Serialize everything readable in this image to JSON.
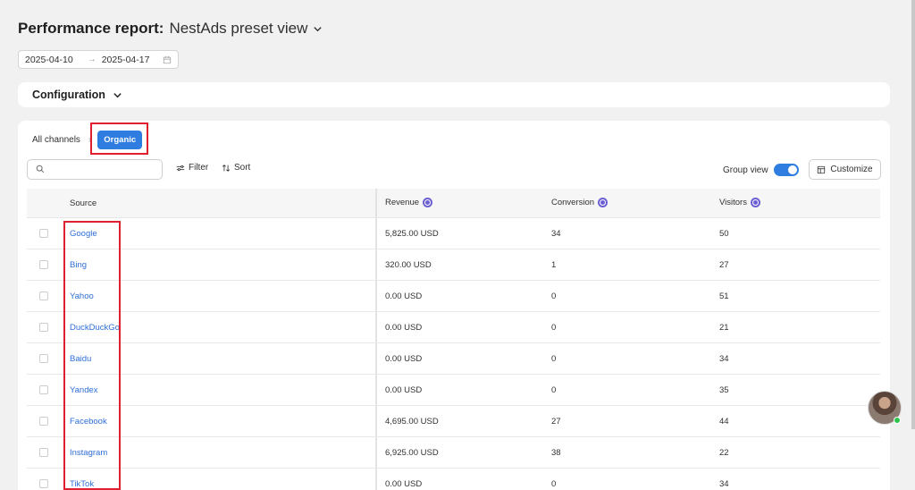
{
  "header": {
    "title": "Performance report:",
    "view_name": "NestAds preset view"
  },
  "date_range": {
    "start": "2025-04-10",
    "arrow": "→",
    "end": "2025-04-17"
  },
  "configuration": {
    "label": "Configuration"
  },
  "breadcrumb": {
    "root": "All channels",
    "separator": "›",
    "current": "Organic"
  },
  "toolbar": {
    "search_placeholder": "",
    "filter_label": "Filter",
    "sort_label": "Sort",
    "group_view_label": "Group view",
    "group_view_on": true,
    "customize_label": "Customize"
  },
  "table": {
    "columns": [
      "Source",
      "Revenue",
      "Conversion",
      "Visitors"
    ],
    "rows": [
      {
        "source": "Google",
        "revenue": "5,825.00 USD",
        "conversion": "34",
        "visitors": "50"
      },
      {
        "source": "Bing",
        "revenue": "320.00 USD",
        "conversion": "1",
        "visitors": "27"
      },
      {
        "source": "Yahoo",
        "revenue": "0.00 USD",
        "conversion": "0",
        "visitors": "51"
      },
      {
        "source": "DuckDuckGo",
        "revenue": "0.00 USD",
        "conversion": "0",
        "visitors": "21"
      },
      {
        "source": "Baidu",
        "revenue": "0.00 USD",
        "conversion": "0",
        "visitors": "34"
      },
      {
        "source": "Yandex",
        "revenue": "0.00 USD",
        "conversion": "0",
        "visitors": "35"
      },
      {
        "source": "Facebook",
        "revenue": "4,695.00 USD",
        "conversion": "27",
        "visitors": "44"
      },
      {
        "source": "Instagram",
        "revenue": "6,925.00 USD",
        "conversion": "38",
        "visitors": "22"
      },
      {
        "source": "TikTok",
        "revenue": "0.00 USD",
        "conversion": "0",
        "visitors": "34"
      }
    ]
  },
  "colors": {
    "accent": "#2f7de1",
    "link": "#2f6fd6",
    "highlight": "#e0202e",
    "info_badge": "#6b5fd3",
    "online": "#2ec44d"
  }
}
